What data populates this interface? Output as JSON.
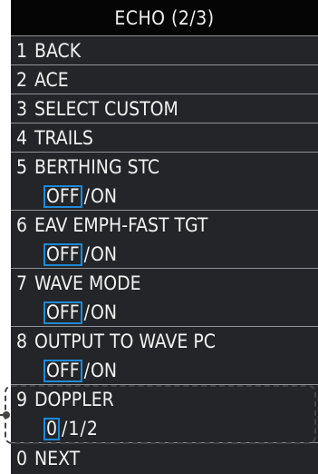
{
  "menu": {
    "title": "ECHO (2/3)",
    "items": [
      {
        "number": "1",
        "label": "BACK"
      },
      {
        "number": "2",
        "label": "ACE"
      },
      {
        "number": "3",
        "label": "SELECT CUSTOM"
      },
      {
        "number": "4",
        "label": "TRAILS"
      },
      {
        "number": "5",
        "label": "BERTHING STC",
        "options": [
          "OFF",
          "ON"
        ],
        "selected": "OFF"
      },
      {
        "number": "6",
        "label": "EAV EMPH-FAST TGT",
        "options": [
          "OFF",
          "ON"
        ],
        "selected": "OFF"
      },
      {
        "number": "7",
        "label": "WAVE MODE",
        "options": [
          "OFF",
          "ON"
        ],
        "selected": "OFF"
      },
      {
        "number": "8",
        "label": "OUTPUT TO WAVE PC",
        "options": [
          "OFF",
          "ON"
        ],
        "selected": "OFF"
      },
      {
        "number": "9",
        "label": "DOPPLER",
        "options": [
          "0",
          "1",
          "2"
        ],
        "selected": "0"
      },
      {
        "number": "0",
        "label": "NEXT"
      }
    ]
  },
  "colors": {
    "background": "#050505",
    "item_background": "#232528",
    "selection_border": "#1f89d8",
    "callout": "#444444"
  }
}
